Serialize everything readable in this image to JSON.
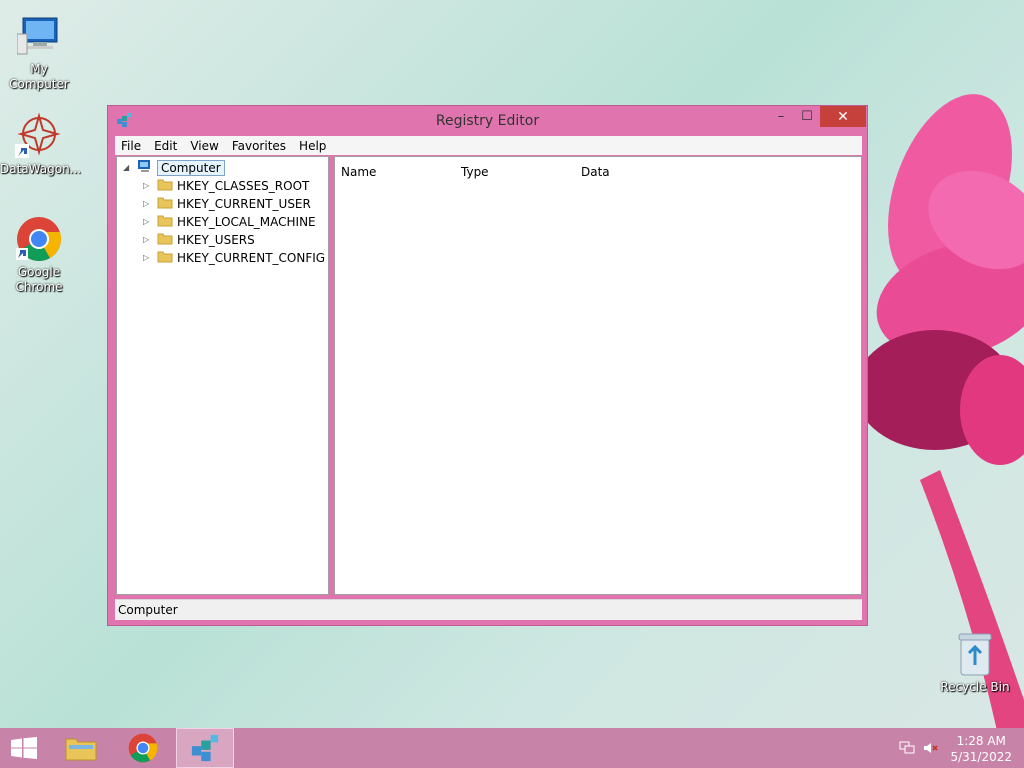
{
  "desktop": {
    "icons": [
      {
        "label": "My Computer"
      },
      {
        "label": "DataWagon..."
      },
      {
        "label": "Google Chrome"
      },
      {
        "label": "Recycle Bin"
      }
    ]
  },
  "window": {
    "title": "Registry Editor",
    "controls": {
      "minimize": "–",
      "maximize": "☐",
      "close": "✕"
    },
    "menu": [
      "File",
      "Edit",
      "View",
      "Favorites",
      "Help"
    ],
    "tree": {
      "root": "Computer",
      "children": [
        "HKEY_CLASSES_ROOT",
        "HKEY_CURRENT_USER",
        "HKEY_LOCAL_MACHINE",
        "HKEY_USERS",
        "HKEY_CURRENT_CONFIG"
      ]
    },
    "list_columns": [
      "Name",
      "Type",
      "Data"
    ],
    "status": "Computer"
  },
  "taskbar": {
    "time": "1:28 AM",
    "date": "5/31/2022"
  },
  "colors": {
    "window_frame": "#e074ae",
    "taskbar": "#c884a8",
    "close_button": "#c7413c"
  }
}
